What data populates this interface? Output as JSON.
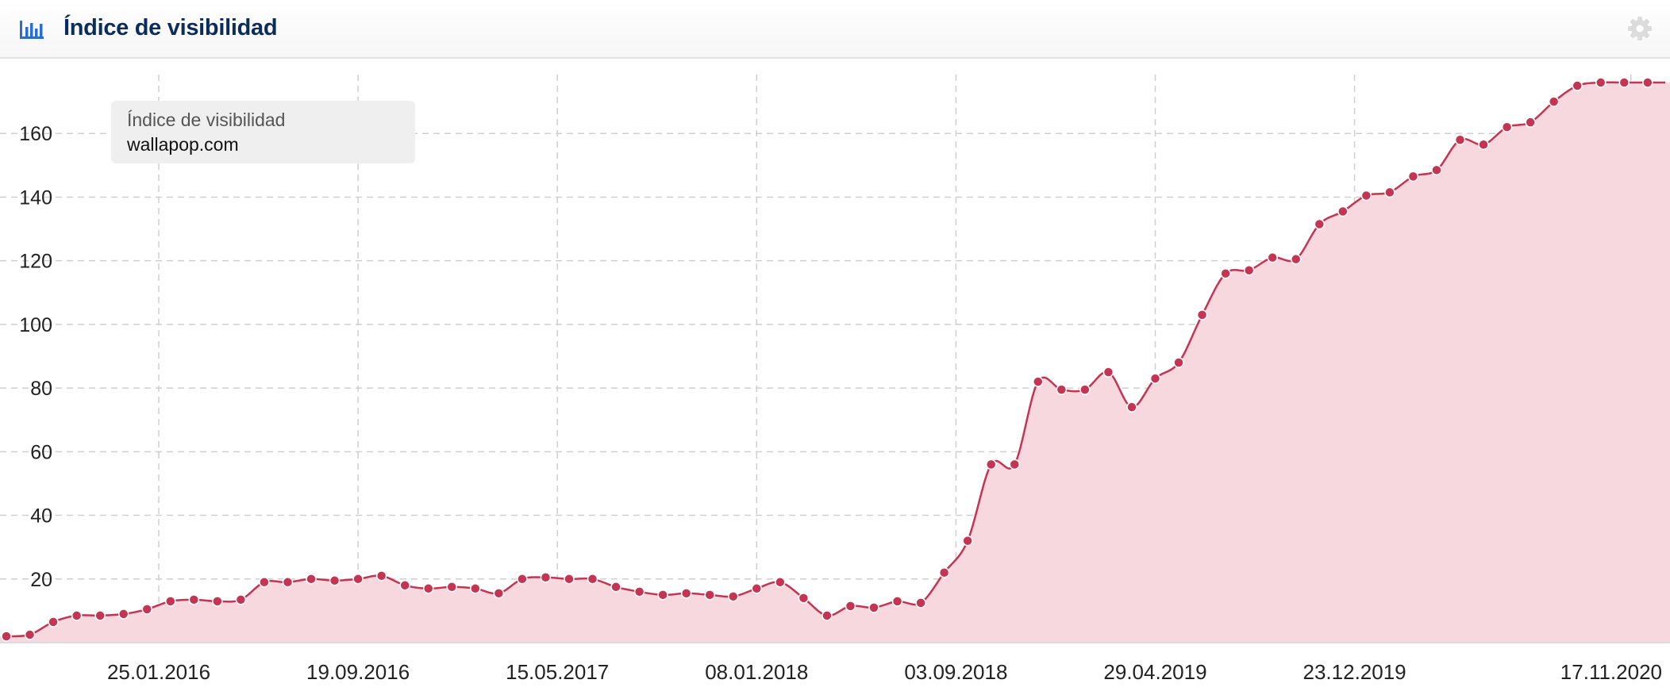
{
  "header": {
    "title": "Índice de visibilidad",
    "icon": "bar-chart-icon",
    "settings_icon": "gear-icon"
  },
  "legend": {
    "title": "Índice de visibilidad",
    "domain": "wallapop.com"
  },
  "colors": {
    "line": "#c33552",
    "fill": "#f6d8de",
    "title": "#0b2d5b",
    "icon": "#2a6fd0",
    "grid": "#cfcfcf"
  },
  "chart_data": {
    "type": "area",
    "x_tick_labels": [
      "25.01.2016",
      "19.09.2016",
      "15.05.2017",
      "08.01.2018",
      "03.09.2018",
      "29.04.2019",
      "23.12.2019",
      "17.11.2020"
    ],
    "y_ticks": [
      20,
      40,
      60,
      80,
      100,
      120,
      140,
      160
    ],
    "ylim": [
      0,
      180
    ],
    "xlim": [
      "2015-07-27",
      "2020-12-28"
    ],
    "grid": true,
    "legend_position": "top-left",
    "series": [
      {
        "name": "wallapop.com",
        "x": [
          "2015-07-27",
          "2015-08-24",
          "2015-09-21",
          "2015-10-19",
          "2015-11-16",
          "2015-12-14",
          "2016-01-11",
          "2016-02-08",
          "2016-03-07",
          "2016-04-04",
          "2016-05-02",
          "2016-05-30",
          "2016-06-27",
          "2016-07-25",
          "2016-08-22",
          "2016-09-19",
          "2016-10-17",
          "2016-11-14",
          "2016-12-12",
          "2017-01-09",
          "2017-02-06",
          "2017-03-06",
          "2017-04-03",
          "2017-05-01",
          "2017-05-29",
          "2017-06-26",
          "2017-07-24",
          "2017-08-21",
          "2017-09-18",
          "2017-10-16",
          "2017-11-13",
          "2017-12-11",
          "2018-01-08",
          "2018-02-05",
          "2018-03-05",
          "2018-04-02",
          "2018-04-30",
          "2018-05-28",
          "2018-06-25",
          "2018-07-23",
          "2018-08-20",
          "2018-09-17",
          "2018-10-15",
          "2018-11-12",
          "2018-12-10",
          "2019-01-07",
          "2019-02-04",
          "2019-03-04",
          "2019-04-01",
          "2019-04-29",
          "2019-05-27",
          "2019-06-24",
          "2019-07-22",
          "2019-08-19",
          "2019-09-16",
          "2019-10-14",
          "2019-11-11",
          "2019-12-09",
          "2020-01-06",
          "2020-02-03",
          "2020-03-02",
          "2020-03-30",
          "2020-04-27",
          "2020-05-25",
          "2020-06-22",
          "2020-07-20",
          "2020-08-17",
          "2020-09-14",
          "2020-10-12",
          "2020-11-09",
          "2020-12-07",
          "2020-12-28"
        ],
        "values": [
          2,
          2.5,
          6.5,
          8.5,
          8.5,
          9,
          10.5,
          13,
          13.5,
          13,
          13.5,
          19,
          19,
          20,
          19.5,
          20,
          21,
          18,
          17,
          17.5,
          17,
          15.5,
          20,
          20.5,
          20,
          20,
          17.5,
          16,
          15,
          15.5,
          15,
          14.5,
          17,
          19,
          14,
          8.5,
          11.5,
          11,
          13,
          12.5,
          22,
          32,
          56,
          56,
          82,
          79.5,
          79.5,
          85,
          74,
          83,
          88,
          103,
          116,
          117,
          121,
          120.5,
          131.5,
          135.5,
          140.5,
          141.5,
          146.5,
          148.5,
          158,
          156.5,
          162,
          163.5,
          170,
          175,
          176,
          176,
          176,
          176
        ]
      }
    ]
  }
}
